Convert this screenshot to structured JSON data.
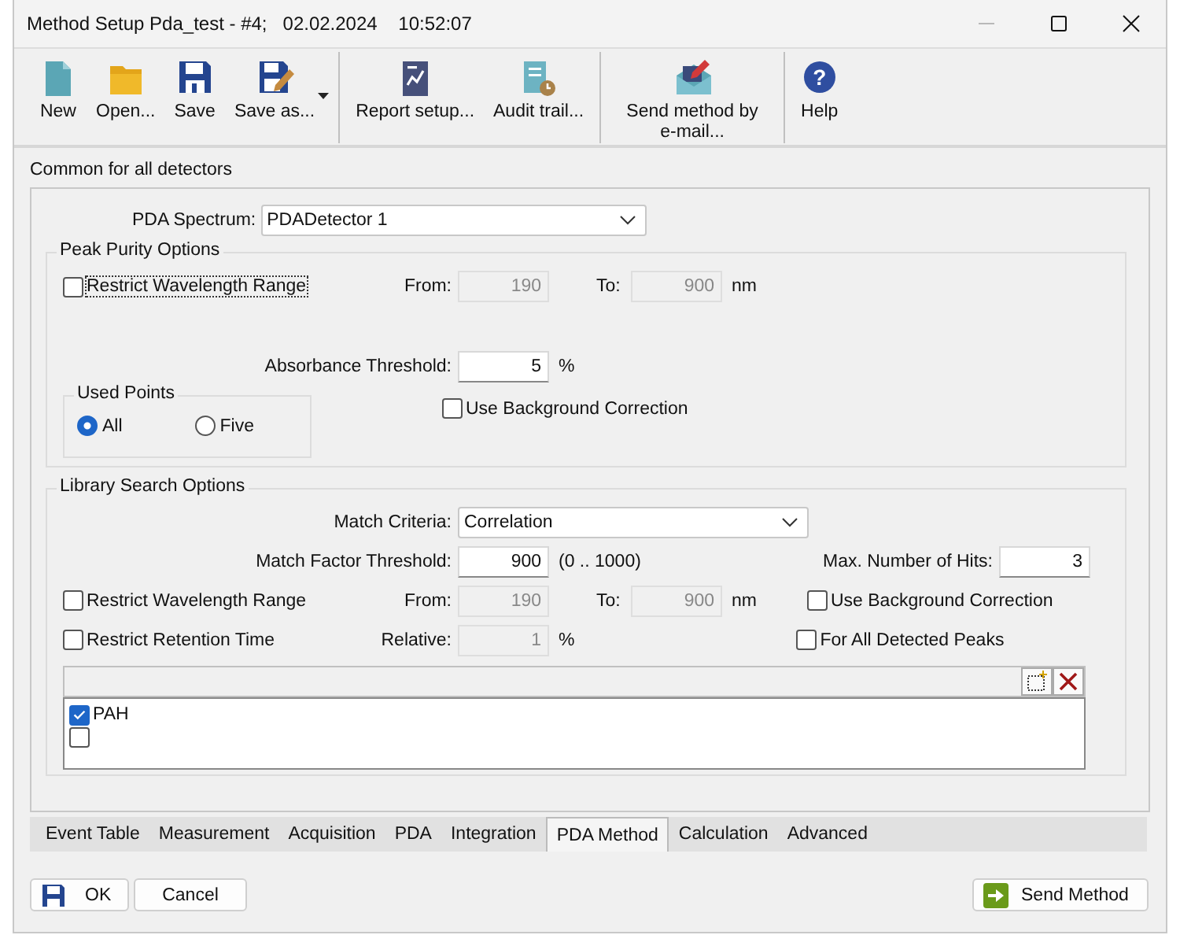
{
  "window": {
    "title": "Method Setup Pda_test - #4;   02.02.2024    10:52:07"
  },
  "toolbar": [
    {
      "group": [
        {
          "label": "New"
        },
        {
          "label": "Open..."
        },
        {
          "label": "Save"
        },
        {
          "label": "Save as...",
          "dropdown": true
        }
      ]
    },
    {
      "group": [
        {
          "label": "Report setup..."
        },
        {
          "label": "Audit trail..."
        }
      ]
    },
    {
      "group": [
        {
          "label": "Send method by e-mail..."
        }
      ]
    },
    {
      "group": [
        {
          "label": "Help",
          "glyph": "?"
        }
      ]
    }
  ],
  "section_label": "Common for all detectors",
  "pda_spectrum": {
    "label": "PDA Spectrum:",
    "value": "PDADetector 1"
  },
  "peak_purity": {
    "title": "Peak Purity Options",
    "restrict": {
      "label": "Restrict Wavelength Range",
      "checked": false,
      "focused": true
    },
    "from": {
      "label": "From:",
      "value": "190",
      "disabled": true
    },
    "to": {
      "label": "To:",
      "value": "900",
      "disabled": true
    },
    "unit": "nm",
    "threshold": {
      "label": "Absorbance Threshold:",
      "value": "5",
      "disabled": false
    },
    "threshold_unit": "%",
    "used_points": {
      "title": "Used Points",
      "options": [
        {
          "label": "All",
          "selected": true
        },
        {
          "label": "Five",
          "selected": false
        }
      ]
    },
    "background": {
      "label": "Use Background Correction",
      "checked": false
    }
  },
  "library": {
    "title": "Library Search Options",
    "match_criteria": {
      "label": "Match Criteria:",
      "value": "Correlation"
    },
    "match_factor": {
      "label": "Match Factor Threshold:",
      "value": "900",
      "disabled": false
    },
    "range": "(0 .. 1000)",
    "max_hits": {
      "label": "Max. Number of Hits:",
      "value": "3",
      "disabled": false
    },
    "restrict": {
      "label": "Restrict Wavelength Range",
      "checked": false
    },
    "from": {
      "label": "From:",
      "value": "190",
      "disabled": true
    },
    "to": {
      "label": "To:",
      "value": "900",
      "disabled": true
    },
    "unit": "nm",
    "background": {
      "label": "Use Background Correction",
      "checked": false
    },
    "retention": {
      "label": "Restrict Retention Time",
      "checked": false
    },
    "relative": {
      "label": "Relative:",
      "value": "1",
      "disabled": true
    },
    "relative_unit": "%",
    "all_peaks": {
      "label": "For All Detected Peaks",
      "checked": false
    },
    "items": [
      {
        "label": "PAH",
        "checked": true
      },
      {
        "checked": false
      }
    ]
  },
  "tabs": [
    {
      "label": "Event Table",
      "selected": false
    },
    {
      "label": "Measurement",
      "selected": false
    },
    {
      "label": "Acquisition",
      "selected": false
    },
    {
      "label": "PDA",
      "selected": false
    },
    {
      "label": "Integration",
      "selected": false
    },
    {
      "label": "PDA Method",
      "selected": true
    },
    {
      "label": "Calculation",
      "selected": false
    },
    {
      "label": "Advanced",
      "selected": false
    }
  ],
  "buttons": {
    "ok": "OK",
    "cancel": "Cancel",
    "send": "Send Method"
  }
}
